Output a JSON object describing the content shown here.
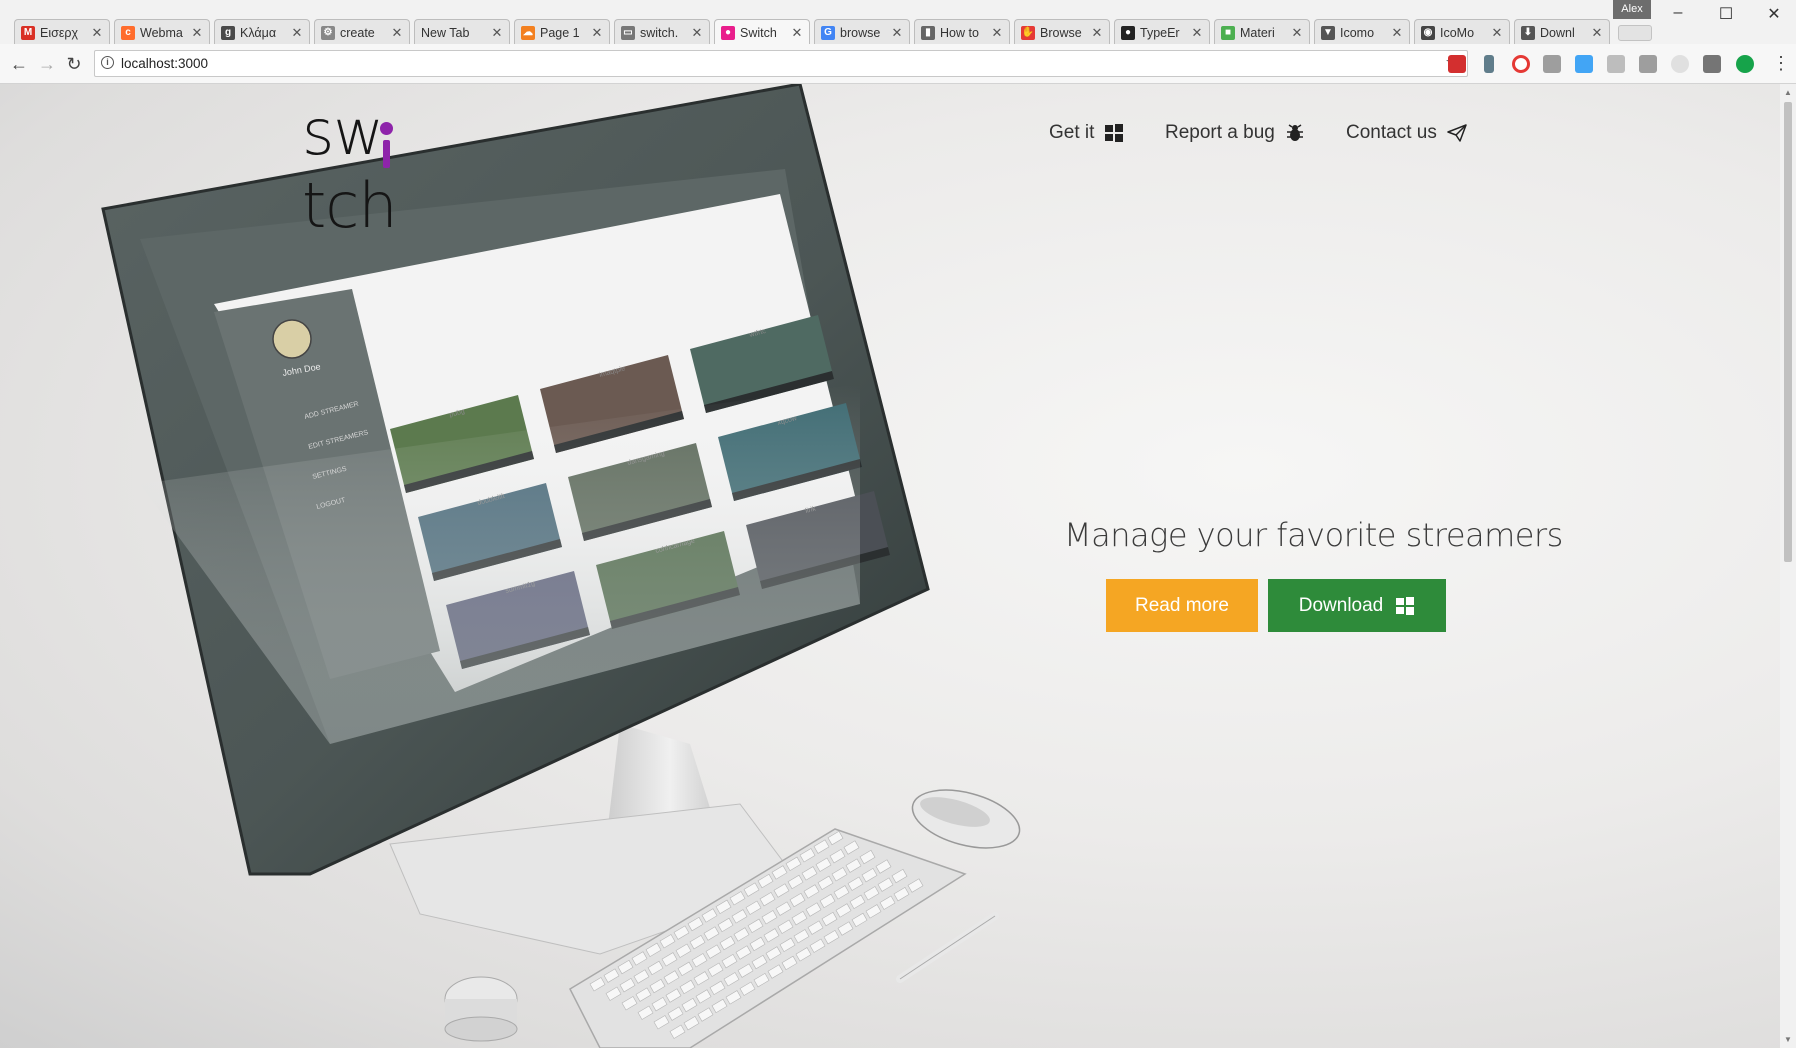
{
  "browser": {
    "profile_name": "Alex",
    "tabs": [
      {
        "title": "Εισερχ",
        "icon": "gmail-icon",
        "color": "#d93025",
        "glyph": "M",
        "active": false
      },
      {
        "title": "Webma",
        "icon": "cpanel-icon",
        "color": "#ff6c2c",
        "glyph": "c",
        "active": false
      },
      {
        "title": "Κλάμα",
        "icon": "g-icon",
        "color": "#4a4a4a",
        "glyph": "g",
        "active": false
      },
      {
        "title": "create",
        "icon": "gear-icon",
        "color": "#888888",
        "glyph": "⚙",
        "active": false
      },
      {
        "title": "New Tab",
        "icon": "",
        "color": "",
        "glyph": "",
        "active": false
      },
      {
        "title": "Page 1",
        "icon": "cloud-icon",
        "color": "#f38020",
        "glyph": "☁",
        "active": false
      },
      {
        "title": "switch.",
        "icon": "document-icon",
        "color": "#777777",
        "glyph": "▭",
        "active": false
      },
      {
        "title": "Switch",
        "icon": "switch-icon",
        "color": "#e91e8c",
        "glyph": "●",
        "active": true
      },
      {
        "title": "browse",
        "icon": "google-icon",
        "color": "#4285f4",
        "glyph": "G",
        "active": false
      },
      {
        "title": "How to",
        "icon": "trash-icon",
        "color": "#666666",
        "glyph": "▮",
        "active": false
      },
      {
        "title": "Browse",
        "icon": "hand-icon",
        "color": "#e53935",
        "glyph": "✋",
        "active": false
      },
      {
        "title": "TypeEr",
        "icon": "github-icon",
        "color": "#222222",
        "glyph": "●",
        "active": false
      },
      {
        "title": "Materi",
        "icon": "material-icon",
        "color": "#4caf50",
        "glyph": "■",
        "active": false
      },
      {
        "title": "Icomo",
        "icon": "funnel-icon",
        "color": "#555555",
        "glyph": "▼",
        "active": false
      },
      {
        "title": "IcoMo",
        "icon": "icomoon-icon",
        "color": "#444444",
        "glyph": "◉",
        "active": false
      },
      {
        "title": "Downl",
        "icon": "download-icon",
        "color": "#555555",
        "glyph": "⬇",
        "active": false
      }
    ],
    "url": "localhost:3000"
  },
  "site": {
    "logo": "switch",
    "nav": [
      {
        "label": "Get it",
        "icon": "windows-icon"
      },
      {
        "label": "Report a bug",
        "icon": "bug-icon"
      },
      {
        "label": "Contact us",
        "icon": "paper-plane-icon"
      }
    ],
    "headline": "Manage your favorite streamers",
    "read_more": "Read more",
    "download": "Download",
    "colors": {
      "read_more": "#f5a623",
      "download": "#2e8b3a",
      "logo_accent": "#8e24aa"
    }
  },
  "screen_app": {
    "user_name": "John Doe",
    "menu": [
      "ADD STREAMER",
      "EDIT STREAMERS",
      "SETTINGS",
      "LOGOUT"
    ],
    "streamers": [
      "pubg",
      "imaqtpie",
      "wtfrtc",
      "doublelift",
      "dansgaming",
      "xqcow",
      "summit1g",
      "cohhcarnage",
      "lirik"
    ]
  }
}
